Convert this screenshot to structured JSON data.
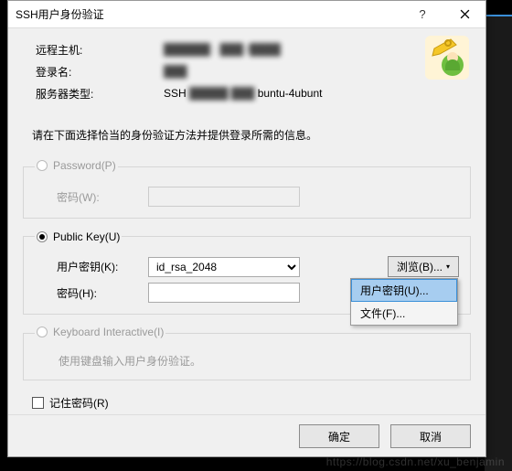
{
  "title": "SSH用户身份验证",
  "help_glyph": "?",
  "header": {
    "remote_label": "远程主机:",
    "remote_value": "██████ · ███ /████",
    "login_label": "登录名:",
    "login_value": "███",
    "servertype_label": "服务器类型:",
    "servertype_prefix": "SSH",
    "servertype_value_blur": "█████ ███",
    "servertype_suffix": "buntu-4ubunt"
  },
  "instruction": "请在下面选择恰当的身份验证方法并提供登录所需的信息。",
  "sections": {
    "password": {
      "legend": "Password(P)",
      "pw_label": "密码(W):"
    },
    "publickey": {
      "legend": "Public Key(U)",
      "userkey_label": "用户密钥(K):",
      "userkey_value": "id_rsa_2048",
      "pw_label": "密码(H):",
      "browse_label": "浏览(B)...",
      "menu": {
        "userkey": "用户密钥(U)...",
        "file": "文件(F)..."
      }
    },
    "kbi": {
      "legend": "Keyboard Interactive(I)",
      "note": "使用键盘输入用户身份验证。"
    }
  },
  "remember_label": "记住密码(R)",
  "footer": {
    "ok": "确定",
    "cancel": "取消"
  },
  "watermark": "https://blog.csdn.net/xu_benjamin"
}
